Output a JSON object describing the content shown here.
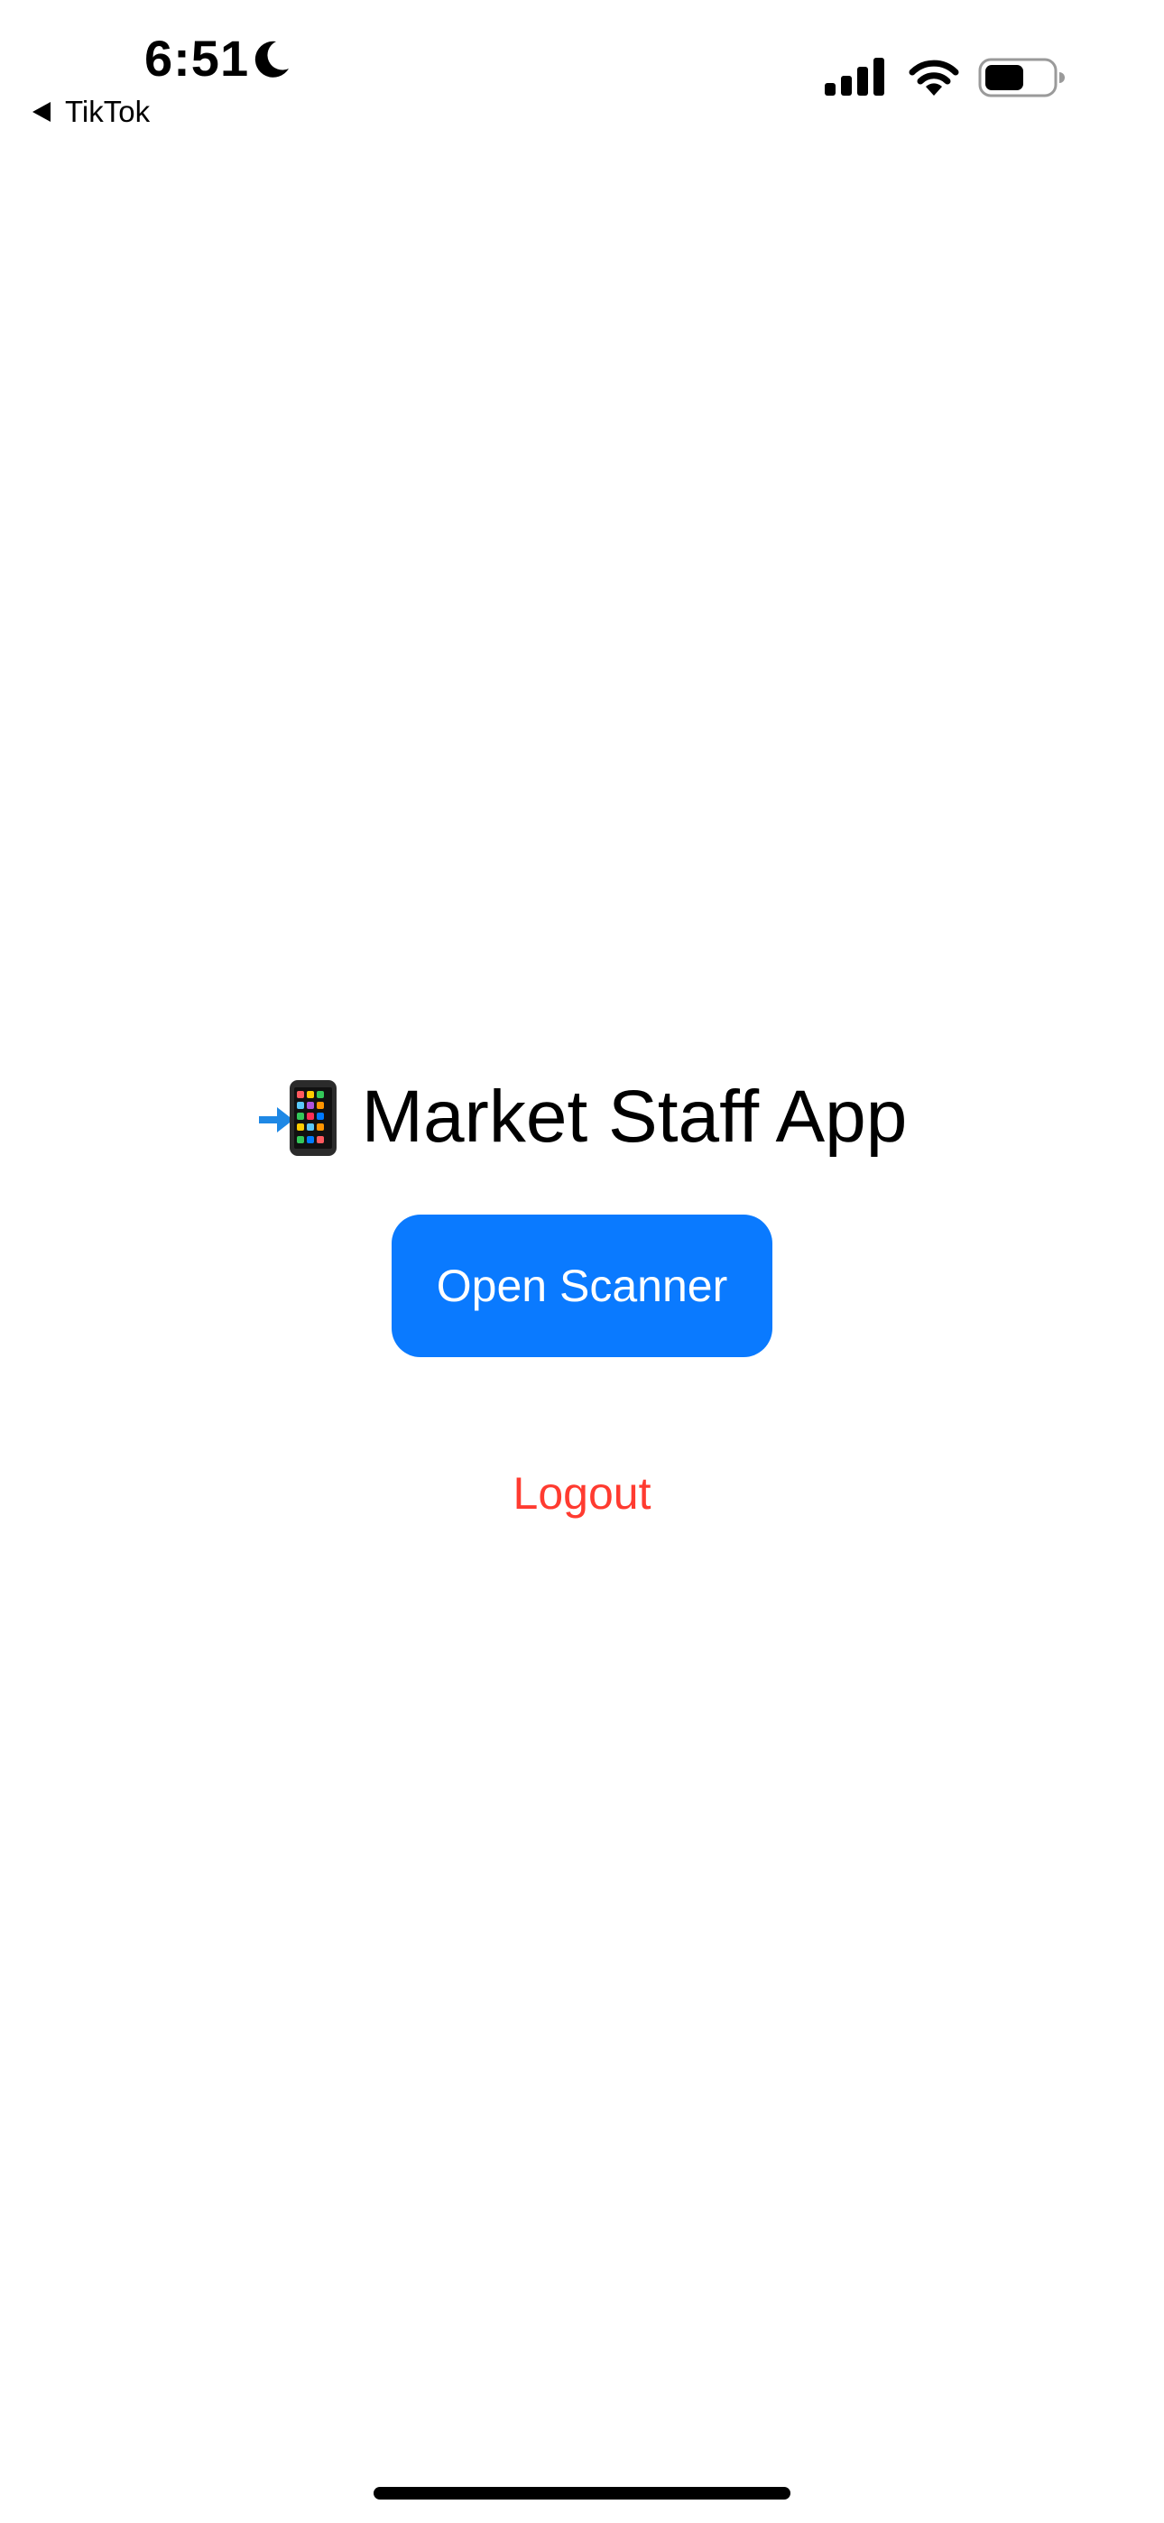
{
  "status_bar": {
    "time": "6:51",
    "back_app_label": "TikTok",
    "icons": [
      "moon-icon",
      "cellular-signal-icon",
      "wifi-icon",
      "battery-icon"
    ]
  },
  "main": {
    "title_emoji_icon": "mobile-phone-with-arrow-icon",
    "title": "Market Staff App",
    "open_scanner_label": "Open Scanner",
    "logout_label": "Logout"
  },
  "colors": {
    "primary_button": "#0a7aff",
    "logout_text": "#ff3b30",
    "background": "#ffffff"
  }
}
